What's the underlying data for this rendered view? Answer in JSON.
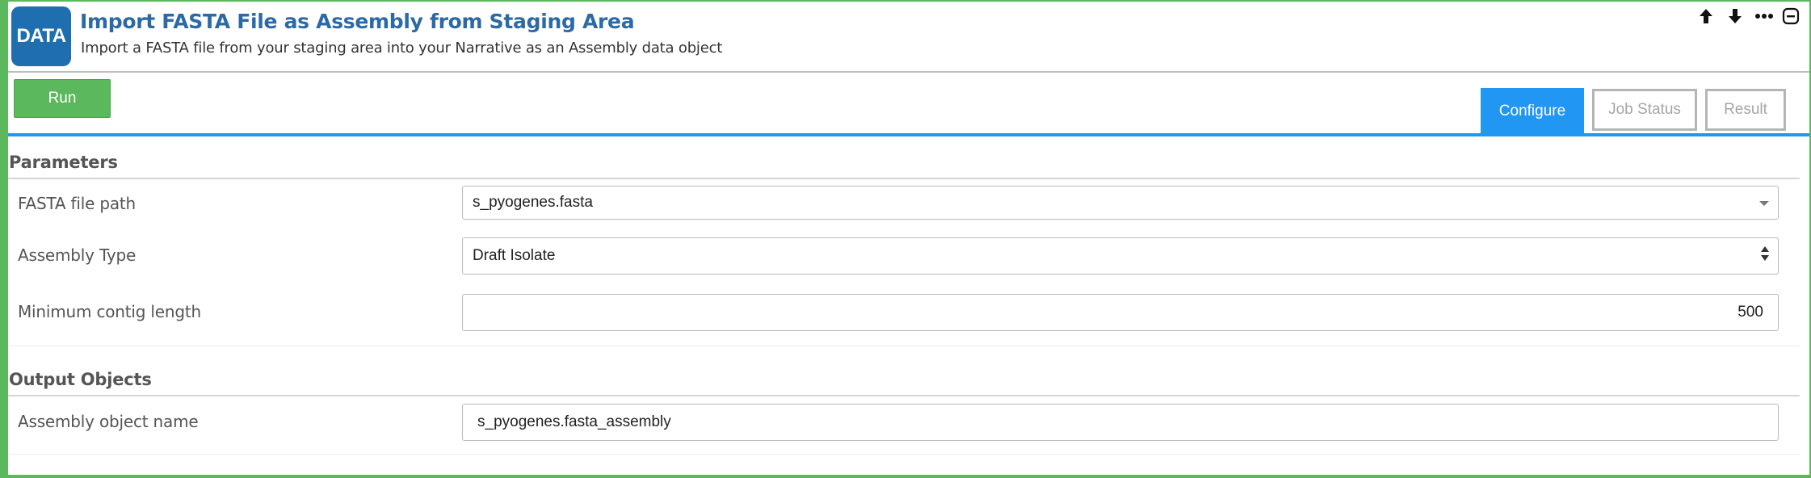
{
  "header": {
    "badge": "DATA",
    "title": "Import FASTA File as Assembly from Staging Area",
    "subtitle": "Import a FASTA file from your staging area into your Narrative as an Assembly data object"
  },
  "controls": {
    "icons": [
      "arrow-up-icon",
      "arrow-down-icon",
      "more-icon",
      "collapse-icon"
    ]
  },
  "toolbar": {
    "run_label": "Run",
    "tabs": [
      {
        "label": "Configure",
        "active": true
      },
      {
        "label": "Job Status",
        "active": false
      },
      {
        "label": "Result",
        "active": false
      }
    ]
  },
  "parameters": {
    "title": "Parameters",
    "fields": [
      {
        "label": "FASTA file path",
        "value": "s_pyogenes.fasta"
      },
      {
        "label": "Assembly Type",
        "value": "Draft Isolate"
      },
      {
        "label": "Minimum contig length",
        "value": "500"
      }
    ]
  },
  "outputs": {
    "title": "Output Objects",
    "fields": [
      {
        "label": "Assembly object name",
        "value": "s_pyogenes.fasta_assembly"
      }
    ]
  },
  "colors": {
    "accent_green": "#5cb85c",
    "accent_blue": "#2196f3",
    "title_blue": "#2b6aa6",
    "badge_blue": "#1f6fb0"
  }
}
